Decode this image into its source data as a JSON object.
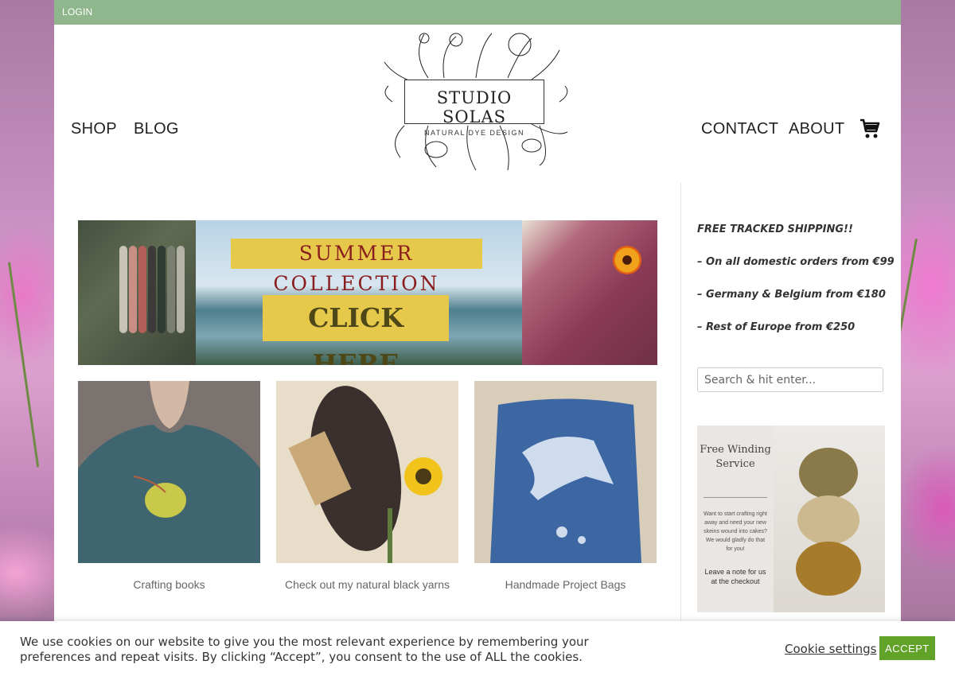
{
  "topbar": {
    "login_label": "LOGIN"
  },
  "nav": {
    "shop": "SHOP",
    "blog": "BLOG",
    "contact": "CONTACT",
    "about": "ABOUT",
    "cart_icon": "cart-icon"
  },
  "logo": {
    "title": "STUDIO SOLAS",
    "subtitle": "NATURAL DYE DESIGN"
  },
  "banner": {
    "title": "SUMMER COLLECTION",
    "cta": "CLICK HERE"
  },
  "tiles": [
    {
      "label": "Crafting books"
    },
    {
      "label": "Check out my natural black yarns"
    },
    {
      "label": "Handmade Project Bags"
    }
  ],
  "sidebar": {
    "shipping_title": "FREE TRACKED SHIPPING!!",
    "shipping_lines": [
      "– On all domestic orders from €99",
      "– Germany & Belgium from €180",
      "– Rest of Europe from €250"
    ],
    "search_placeholder": "Search & hit enter...",
    "promo": {
      "heading": "Free Winding Service",
      "body": "Want to start crafting right away and need your new skeins wound into cakes? We would gladly do that for you!",
      "note": "Leave a note for us at the checkout"
    }
  },
  "cookie": {
    "text": "We use cookies on our website to give you the most relevant experience by remembering your preferences and repeat visits. By clicking “Accept”, you consent to the use of ALL the cookies.",
    "settings_label": "Cookie settings",
    "accept_label": "ACCEPT"
  },
  "colors": {
    "topbar": "#8fb68c",
    "accept_button": "#61a229",
    "banner_label_bg": "#e6c84a"
  }
}
